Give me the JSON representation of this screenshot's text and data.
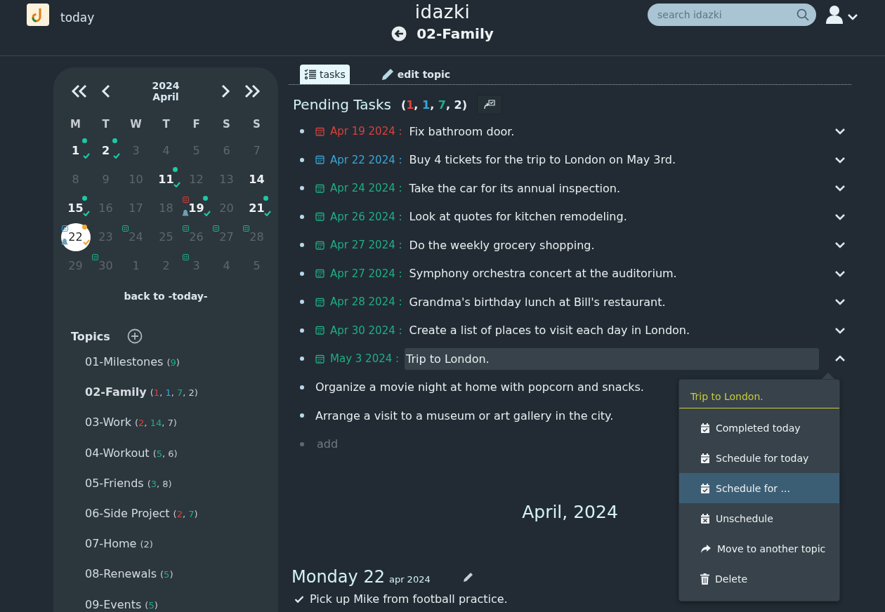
{
  "header": {
    "today_link": "today",
    "brand": "idazki",
    "search": {
      "placeholder": "search idazki"
    },
    "topic_title": "02-Family"
  },
  "calendar": {
    "year": "2024",
    "month": "April",
    "weekdays": [
      "M",
      "T",
      "W",
      "T",
      "F",
      "S",
      "S"
    ],
    "days": [
      {
        "day": "1",
        "bold": true,
        "selected": false,
        "markers": [
          {
            "kind": "dot",
            "color": "#1ec8a5"
          },
          {
            "kind": "check",
            "color": "#1ec8a5"
          }
        ]
      },
      {
        "day": "2",
        "bold": true,
        "selected": false,
        "markers": [
          {
            "kind": "dot",
            "color": "#1ec8a5"
          },
          {
            "kind": "check",
            "color": "#1ec8a5"
          }
        ]
      },
      {
        "day": "3",
        "bold": false,
        "selected": false
      },
      {
        "day": "4",
        "bold": false,
        "selected": false
      },
      {
        "day": "5",
        "bold": false,
        "selected": false
      },
      {
        "day": "6",
        "bold": false,
        "selected": false
      },
      {
        "day": "7",
        "bold": false,
        "selected": false
      },
      {
        "day": "8",
        "bold": false,
        "selected": false
      },
      {
        "day": "9",
        "bold": false,
        "selected": false
      },
      {
        "day": "10",
        "bold": false,
        "selected": false
      },
      {
        "day": "11",
        "bold": true,
        "selected": false,
        "markers": [
          {
            "kind": "dot",
            "color": "#1ec8a5"
          },
          {
            "kind": "check",
            "color": "#1ec8a5"
          }
        ]
      },
      {
        "day": "12",
        "bold": false,
        "selected": false
      },
      {
        "day": "13",
        "bold": false,
        "selected": false
      },
      {
        "day": "14",
        "bold": true,
        "selected": false
      },
      {
        "day": "15",
        "bold": true,
        "selected": false,
        "markers": [
          {
            "kind": "dot",
            "color": "#1ec8a5"
          },
          {
            "kind": "check",
            "color": "#1ec8a5"
          }
        ]
      },
      {
        "day": "16",
        "bold": false,
        "selected": false
      },
      {
        "day": "17",
        "bold": false,
        "selected": false
      },
      {
        "day": "18",
        "bold": false,
        "selected": false
      },
      {
        "day": "19",
        "bold": true,
        "selected": false,
        "markers": [
          {
            "kind": "task",
            "color": "#c9433f"
          },
          {
            "kind": "bell"
          },
          {
            "kind": "dot",
            "color": "#1ec8a5"
          },
          {
            "kind": "check",
            "color": "#1ec8a5"
          }
        ]
      },
      {
        "day": "20",
        "bold": false,
        "selected": false
      },
      {
        "day": "21",
        "bold": true,
        "selected": false,
        "markers": [
          {
            "kind": "dot",
            "color": "#1ec8a5"
          },
          {
            "kind": "check",
            "color": "#1ec8a5"
          }
        ]
      },
      {
        "day": "22",
        "bold": false,
        "selected": true,
        "markers": [
          {
            "kind": "task",
            "color": "#3aa6d8"
          },
          {
            "kind": "bell"
          },
          {
            "kind": "dot",
            "color": "#f0a830"
          },
          {
            "kind": "check",
            "color": "#f0a830"
          }
        ]
      },
      {
        "day": "23",
        "bold": false,
        "selected": false
      },
      {
        "day": "24",
        "bold": false,
        "selected": false,
        "markers": [
          {
            "kind": "task",
            "color": "#1fae84"
          }
        ]
      },
      {
        "day": "25",
        "bold": false,
        "selected": false
      },
      {
        "day": "26",
        "bold": false,
        "selected": false,
        "markers": [
          {
            "kind": "task",
            "color": "#1fae84"
          }
        ]
      },
      {
        "day": "27",
        "bold": false,
        "selected": false,
        "markers": [
          {
            "kind": "task",
            "color": "#1fae84"
          }
        ]
      },
      {
        "day": "28",
        "bold": false,
        "selected": false,
        "markers": [
          {
            "kind": "task",
            "color": "#1fae84"
          }
        ]
      },
      {
        "day": "29",
        "bold": false,
        "selected": false
      },
      {
        "day": "30",
        "bold": false,
        "selected": false,
        "markers": [
          {
            "kind": "task",
            "color": "#1fae84"
          }
        ]
      },
      {
        "day": "1",
        "bold": false,
        "selected": false
      },
      {
        "day": "2",
        "bold": false,
        "selected": false
      },
      {
        "day": "3",
        "bold": false,
        "selected": false,
        "markers": [
          {
            "kind": "task",
            "color": "#1fae84"
          }
        ]
      },
      {
        "day": "4",
        "bold": false,
        "selected": false
      },
      {
        "day": "5",
        "bold": false,
        "selected": false
      }
    ],
    "back_link": "back to -today-"
  },
  "topics": {
    "title": "Topics",
    "items": [
      {
        "name": "01-Milestones",
        "selected": false,
        "counts": [
          "(",
          {
            "value": "9",
            "color": "#1fae84"
          },
          ")"
        ]
      },
      {
        "name": "02-Family",
        "selected": true,
        "counts": [
          "(",
          {
            "value": "1",
            "color": "#d8423e"
          },
          ", ",
          {
            "value": "1",
            "color": "#3aa6d8"
          },
          ", ",
          {
            "value": "7",
            "color": "#1fae84"
          },
          ", ",
          {
            "value": "2",
            "color": "#c6ccd0"
          },
          ")"
        ]
      },
      {
        "name": "03-Work",
        "selected": false,
        "counts": [
          "(",
          {
            "value": "2",
            "color": "#d8423e"
          },
          ", ",
          {
            "value": "14",
            "color": "#1fae84"
          },
          ", ",
          {
            "value": "7",
            "color": "#c6ccd0"
          },
          ")"
        ]
      },
      {
        "name": "04-Workout",
        "selected": false,
        "counts": [
          "(",
          {
            "value": "5",
            "color": "#1fae84"
          },
          ", ",
          {
            "value": "6",
            "color": "#c6ccd0"
          },
          ")"
        ]
      },
      {
        "name": "05-Friends",
        "selected": false,
        "counts": [
          "(",
          {
            "value": "3",
            "color": "#1fae84"
          },
          ", ",
          {
            "value": "8",
            "color": "#c6ccd0"
          },
          ")"
        ]
      },
      {
        "name": "06-Side Project",
        "selected": false,
        "counts": [
          "(",
          {
            "value": "2",
            "color": "#d8423e"
          },
          ", ",
          {
            "value": "7",
            "color": "#1fae84"
          },
          ")"
        ]
      },
      {
        "name": "07-Home",
        "selected": false,
        "counts": [
          "(",
          {
            "value": "2",
            "color": "#c6ccd0"
          },
          ")"
        ]
      },
      {
        "name": "08-Renewals",
        "selected": false,
        "counts": [
          "(",
          {
            "value": "5",
            "color": "#1fae84"
          },
          ")"
        ]
      },
      {
        "name": "09-Events",
        "selected": false,
        "counts": [
          "(",
          {
            "value": "5",
            "color": "#1fae84"
          },
          ")"
        ]
      }
    ]
  },
  "tabs": [
    {
      "label": "tasks",
      "selected": true
    },
    {
      "label": "edit topic",
      "selected": false
    }
  ],
  "pending": {
    "title": "Pending Tasks",
    "counts": [
      "(",
      {
        "value": "1",
        "color": "#e0443e"
      },
      ", ",
      {
        "value": "1",
        "color": "#3aa6d8"
      },
      ", ",
      {
        "value": "7",
        "color": "#1fae84"
      },
      ", ",
      {
        "value": "2",
        "color": "#e8eef0"
      },
      ")"
    ],
    "tasks": [
      {
        "kind": "dated",
        "date": "Apr 19 2024 :",
        "color": "#d8423e",
        "text": "Fix bathroom door.",
        "selected": false,
        "expanded": false
      },
      {
        "kind": "dated",
        "date": "Apr 22 2024 :",
        "color": "#3aa6d8",
        "text": "Buy 4 tickets for the trip to London on May 3rd.",
        "selected": false,
        "expanded": false
      },
      {
        "kind": "dated",
        "date": "Apr 24 2024 :",
        "color": "#1fae84",
        "text": "Take the car for its annual inspection.",
        "selected": false,
        "expanded": false
      },
      {
        "kind": "dated",
        "date": "Apr 26 2024 :",
        "color": "#1fae84",
        "text": "Look at quotes for kitchen remodeling.",
        "selected": false,
        "expanded": false
      },
      {
        "kind": "dated",
        "date": "Apr 27 2024 :",
        "color": "#1fae84",
        "text": "Do the weekly grocery shopping.",
        "selected": false,
        "expanded": false
      },
      {
        "kind": "dated",
        "date": "Apr 27 2024 :",
        "color": "#1fae84",
        "text": "Symphony orchestra concert at the auditorium.",
        "selected": false,
        "expanded": false
      },
      {
        "kind": "dated",
        "date": "Apr 28 2024 :",
        "color": "#1fae84",
        "text": "Grandma's birthday lunch at Bill's restaurant.",
        "selected": false,
        "expanded": false
      },
      {
        "kind": "dated",
        "date": "Apr 30 2024 :",
        "color": "#1fae84",
        "text": "Create a list of places to visit each day in London.",
        "selected": false,
        "expanded": false
      },
      {
        "kind": "dated",
        "date": "May 3 2024 :",
        "color": "#1fae84",
        "text": "Trip to London.",
        "selected": true,
        "expanded": true
      },
      {
        "kind": "undated",
        "text": "Organize a movie night at home with popcorn and snacks."
      },
      {
        "kind": "undated",
        "text": "Arrange a visit to a museum or art gallery in the city."
      }
    ],
    "add": {
      "placeholder": "add"
    }
  },
  "menu": {
    "title": "Trip to London.",
    "items": [
      {
        "kind": "schedule",
        "label": "Completed today",
        "selected": false
      },
      {
        "kind": "schedule",
        "label": "Schedule for today",
        "selected": false
      },
      {
        "kind": "schedule",
        "label": "Schedule for ...",
        "selected": true
      },
      {
        "kind": "unschedule",
        "label": "Unschedule",
        "selected": false
      },
      {
        "kind": "move",
        "label": "Move to another topic",
        "selected": false
      },
      {
        "kind": "delete",
        "label": "Delete",
        "selected": false
      }
    ]
  },
  "month_heading": "April, 2024",
  "day": {
    "weekday": "Monday 22",
    "date": "apr 2024",
    "entries": [
      {
        "text": "Pick up Mike from football practice.",
        "done": true
      }
    ]
  }
}
